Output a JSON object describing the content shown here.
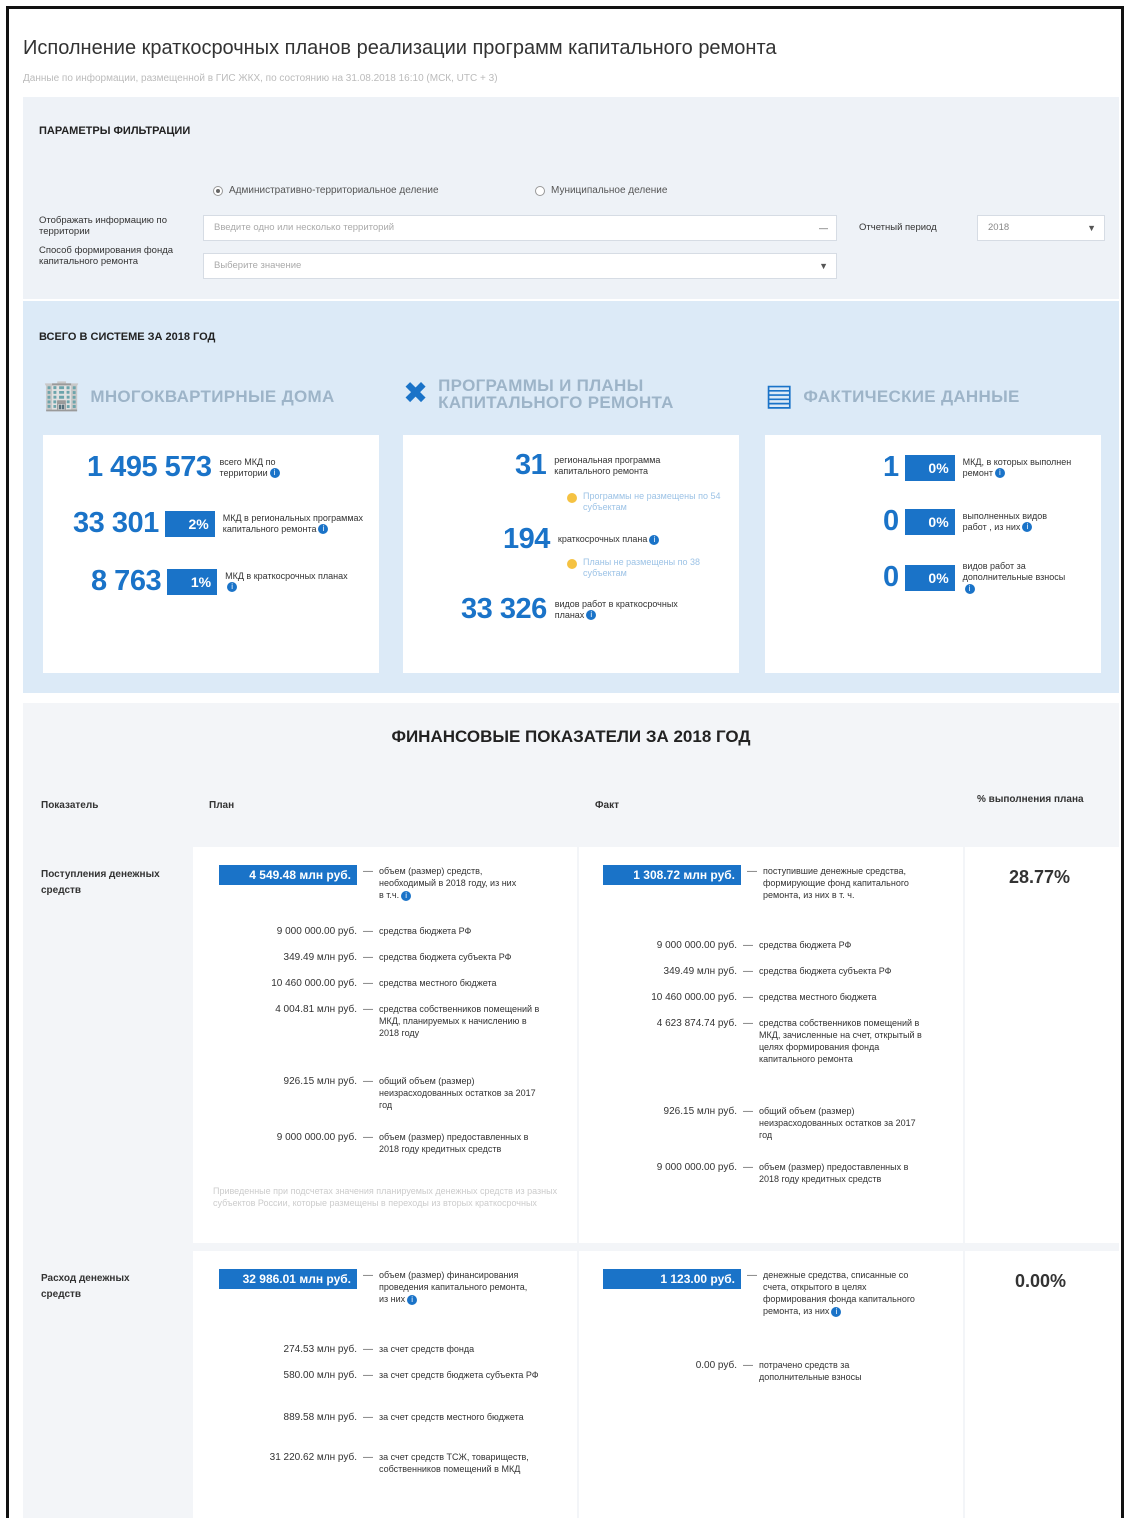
{
  "page": {
    "title": "Исполнение краткосрочных планов реализации программ капитального ремонта",
    "subtitle": "Данные по информации, размещенной в ГИС ЖКХ, по состоянию на 31.08.2018 16:10 (МСК, UTC + 3)"
  },
  "filters": {
    "heading": "ПАРАМЕТРЫ ФИЛЬТРАЦИИ",
    "radio_admin": "Административно-территориальное деление",
    "radio_mun": "Муниципальное деление",
    "territory_label": "Отображать информацию по территории",
    "territory_placeholder": "Введите одно или несколько территорий",
    "method_label": "Способ формирования фонда капитального ремонта",
    "method_placeholder": "Выберите значение",
    "period_label": "Отчетный период",
    "period_value": "2018"
  },
  "totals": {
    "heading": "ВСЕГО В СИСТЕМЕ ЗА 2018 ГОД",
    "houses": {
      "title": "МНОГОКВАРТИРНЫЕ ДОМА",
      "s1_value": "1 495 573",
      "s1_desc": "всего МКД по территории",
      "s2_value": "33 301",
      "s2_pct": "2%",
      "s2_desc": "МКД в региональных программах капитального ремонта",
      "s3_value": "8 763",
      "s3_pct": "1%",
      "s3_desc": "МКД в краткосрочных планах"
    },
    "programs": {
      "title1": "ПРОГРАММЫ И ПЛАНЫ",
      "title2": "КАПИТАЛЬНОГО РЕМОНТА",
      "s1_value": "31",
      "s1_desc": "региональная программа капитального ремонта",
      "w1": "Программы не размещены по 54 субъектам",
      "s2_value": "194",
      "s2_desc": "краткосрочных плана",
      "w2": "Планы не размещены по 38 субъектам",
      "s3_value": "33 326",
      "s3_desc": "видов работ в краткосрочных планах"
    },
    "actual": {
      "title": "ФАКТИЧЕСКИЕ ДАННЫЕ",
      "s1_value": "1",
      "s1_pct": "0%",
      "s1_desc": "МКД, в которых выполнен ремонт",
      "s2_value": "0",
      "s2_pct": "0%",
      "s2_desc": "выполненных видов работ , из них",
      "s3_value": "0",
      "s3_pct": "0%",
      "s3_desc": "видов работ за дополнительные взносы"
    }
  },
  "finance": {
    "heading": "ФИНАНСОВЫЕ ПОКАЗАТЕЛИ ЗА 2018 ГОД",
    "col_indicator": "Показатель",
    "col_plan": "План",
    "col_fact": "Факт",
    "col_pct": "% выполнения плана",
    "income": {
      "label": "Поступления денежных средств",
      "plan_badge": "4 549.48 млн руб.",
      "plan_badge_desc": "объем (размер) средств, необходимый в 2018 году, из них в т.ч.",
      "plan_lines": [
        {
          "v": "9 000 000.00 руб.",
          "d": "средства бюджета РФ"
        },
        {
          "v": "349.49 млн руб.",
          "d": "средства бюджета субъекта РФ"
        },
        {
          "v": "10 460 000.00 руб.",
          "d": "средства местного бюджета"
        },
        {
          "v": "4 004.81 млн руб.",
          "d": "средства собственников помещений в МКД, планируемых к начислению в 2018 году"
        },
        {
          "v": "926.15 млн руб.",
          "d": "общий объем (размер) неизрасходованных остатков за 2017 год"
        },
        {
          "v": "9 000 000.00 руб.",
          "d": "объем (размер) предоставленных в 2018 году кредитных средств"
        }
      ],
      "plan_note": "Приведенные при подсчетах значения планируемых денежных средств из разных субъектов России, которые размещены в переходы из вторых краткосрочных",
      "fact_badge": "1 308.72 млн руб.",
      "fact_badge_desc": "поступившие денежные средства, формирующие фонд капитального ремонта, из них в т. ч.",
      "fact_lines": [
        {
          "v": "9 000 000.00 руб.",
          "d": "средства бюджета РФ"
        },
        {
          "v": "349.49 млн руб.",
          "d": "средства бюджета субъекта РФ"
        },
        {
          "v": "10 460 000.00 руб.",
          "d": "средства местного бюджета"
        },
        {
          "v": "4 623 874.74 руб.",
          "d": "средства собственников помещений в МКД, зачисленные на счет, открытый в целях формирования фонда капитального ремонта"
        },
        {
          "v": "926.15 млн руб.",
          "d": "общий объем (размер) неизрасходованных остатков за 2017 год"
        },
        {
          "v": "9 000 000.00 руб.",
          "d": "объем (размер) предоставленных в 2018 году кредитных средств"
        }
      ],
      "percent": "28.77%"
    },
    "expense": {
      "label": "Расход денежных средств",
      "plan_badge": "32 986.01 млн руб.",
      "plan_badge_desc": "объем (размер) финансирования проведения капитального ремонта, из них",
      "plan_lines": [
        {
          "v": "274.53 млн руб.",
          "d": "за счет средств фонда"
        },
        {
          "v": "580.00 млн руб.",
          "d": "за счет средств бюджета субъекта РФ"
        },
        {
          "v": "889.58 млн руб.",
          "d": "за счет средств местного бюджета"
        },
        {
          "v": "31 220.62 млн руб.",
          "d": "за счет средств ТСЖ, товариществ, собственников помещений в МКД"
        }
      ],
      "fact_badge": "1 123.00 руб.",
      "fact_badge_desc": "денежные средства, списанные со счета, открытого в целях формирования фонда капитального ремонта, из них",
      "fact_lines": [
        {
          "v": "0.00 руб.",
          "d": "потрачено средств за дополнительные взносы"
        }
      ],
      "percent": "0.00%"
    }
  },
  "colors": {
    "accent": "#1a73c8",
    "warning": "#f5c242"
  }
}
